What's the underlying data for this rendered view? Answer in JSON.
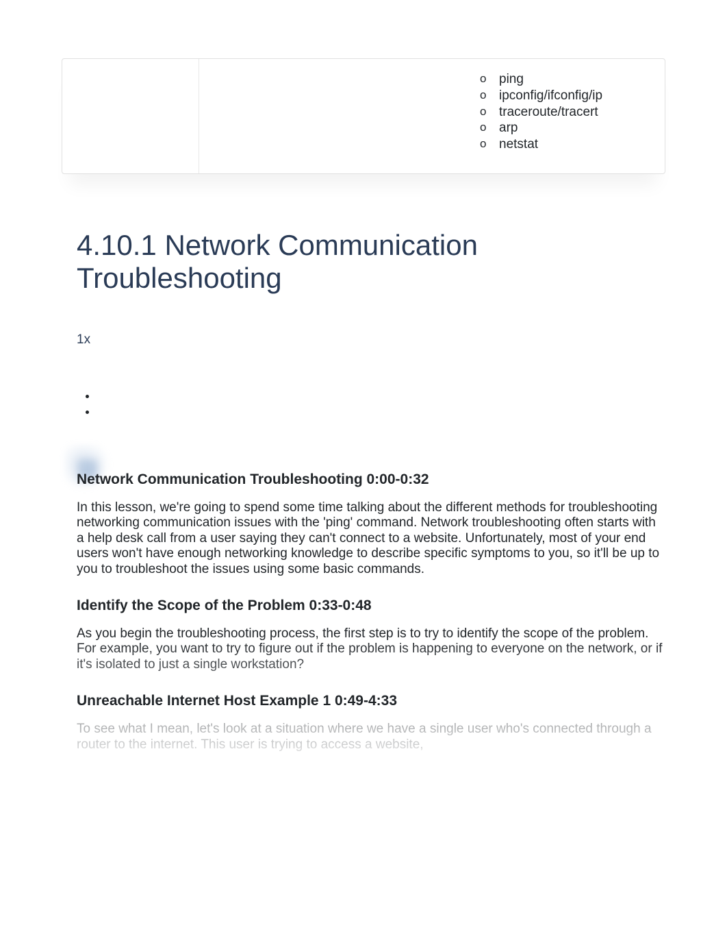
{
  "top_list": {
    "items": [
      "ping",
      "ipconfig/ifconfig/ip",
      "traceroute/tracert",
      "arp",
      "netstat"
    ]
  },
  "title": "4.10.1 Network Communication Troubleshooting",
  "playback_speed": "1x",
  "sections": [
    {
      "heading": "Network Communication Troubleshooting 0:00-0:32",
      "body": "In this lesson, we're going to spend some time talking about the different methods for troubleshooting networking communication issues with the 'ping' command. Network troubleshooting often starts with a help desk call from a user saying they can't connect to a website. Unfortunately, most of your end users won't have enough networking knowledge to describe specific symptoms to you, so it'll be up to you to troubleshoot the issues using some basic commands."
    },
    {
      "heading": "Identify the Scope of the Problem 0:33-0:48",
      "body": "As you begin the troubleshooting process, the first step is to try to identify the scope of the problem. For example, you want to try to figure out if the problem is happening to everyone on the network, or if it's isolated to just a single workstation?"
    },
    {
      "heading": "Unreachable Internet Host Example 1 0:49-4:33",
      "body": "To see what I mean, let's look at a situation where we have a single user who's connected through a router to the internet. This user is trying to access a website,"
    }
  ]
}
